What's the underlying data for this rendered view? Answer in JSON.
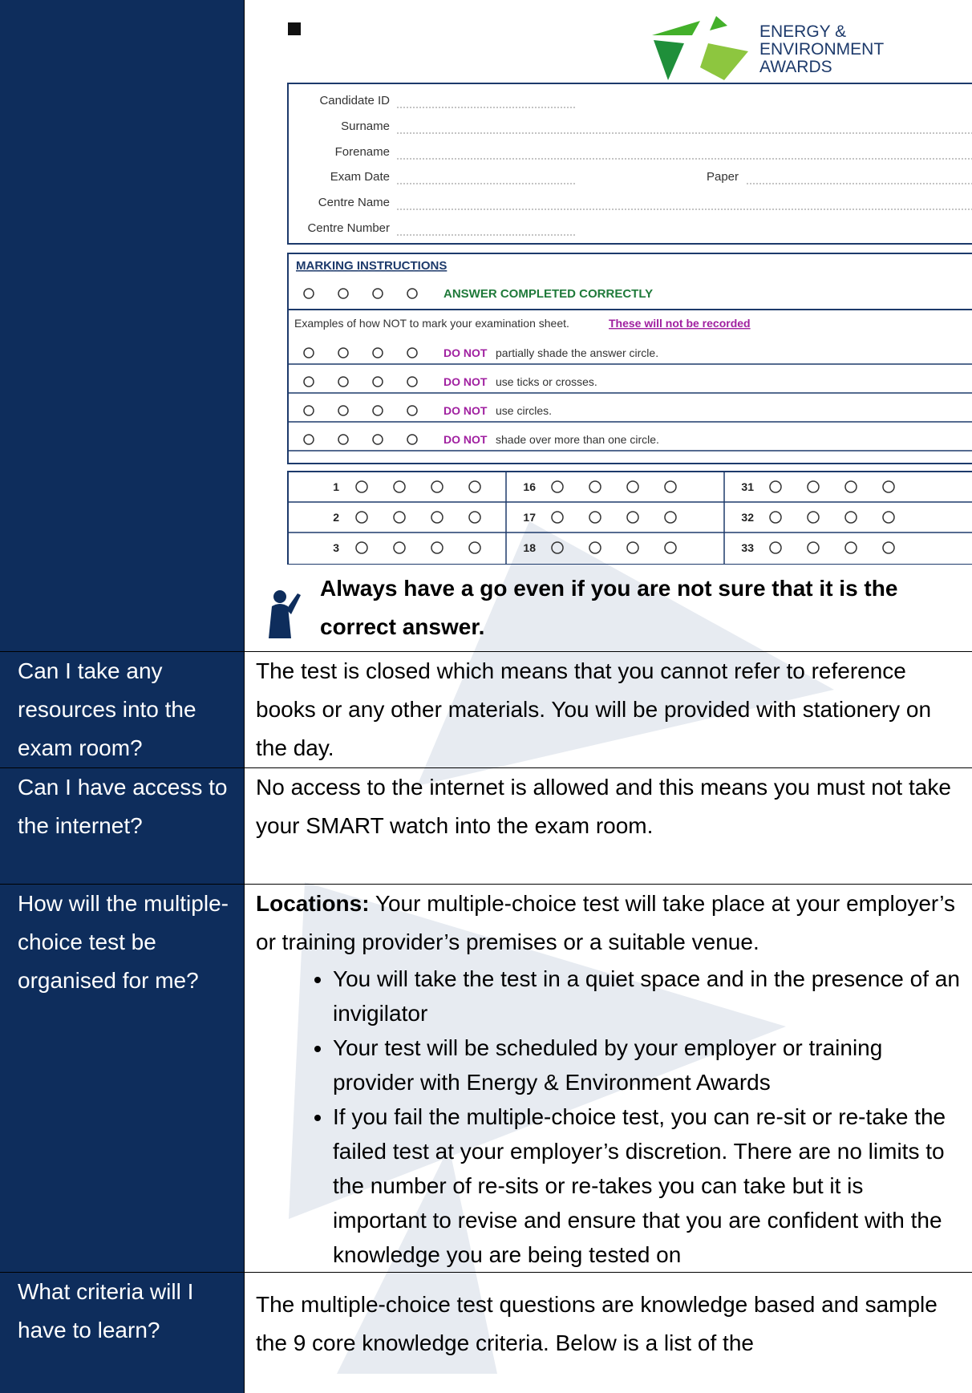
{
  "watermark_color": "#e7ebf1",
  "sheet": {
    "logo_text": [
      "ENERGY &",
      "ENVIRONMENT",
      "AWARDS"
    ],
    "fields": [
      "Candidate ID",
      "Surname",
      "Forename",
      "Exam Date",
      "Centre Name",
      "Centre Number"
    ],
    "paper_label": "Paper",
    "marking_title": "MARKING INSTRUCTIONS",
    "correct_label": "ANSWER COMPLETED CORRECTLY",
    "examples_intro": "Examples of how NOT to mark your examination sheet.",
    "examples_note": "These will not be recorded",
    "do_not": "DO NOT",
    "rules": [
      "partially shade the answer circle.",
      "use ticks or crosses.",
      "use circles.",
      "shade over more than one circle."
    ],
    "question_numbers": [
      [
        "1",
        "16",
        "31"
      ],
      [
        "2",
        "17",
        "32"
      ],
      [
        "3",
        "18",
        "33"
      ]
    ]
  },
  "tip": "Always have a go even if you are not sure that it is the correct answer.",
  "rows": [
    {
      "question": "Can I take any resources into the exam room?",
      "answer": "The test is closed which means that you cannot refer to reference books or any other materials. You will be provided with stationery on the day."
    },
    {
      "question": "Can I have access to the internet?",
      "answer": "No access to the internet is allowed and this means you must not take your SMART watch into the exam room."
    },
    {
      "question": "How will the multiple-choice test be organised for me?",
      "lead_bold": "Locations:",
      "lead_text": " Your multiple-choice test will take place at your employer’s or training provider’s premises or a suitable venue.",
      "bullets": [
        "You will take the test in a quiet space and in the presence of an invigilator",
        "Your test will be scheduled by your employer or training provider with Energy & Environment Awards",
        "If you fail the multiple-choice test, you can re-sit or re-take the failed test at your employer’s discretion. There are no limits to the number of re-sits or re-takes you can take but it is important to revise and ensure that you are confident with the knowledge you are being tested on"
      ]
    },
    {
      "question": "What criteria will I have to learn?",
      "answer": "The multiple-choice test questions are knowledge based and sample the 9 core knowledge criteria. Below is a list of the"
    }
  ]
}
